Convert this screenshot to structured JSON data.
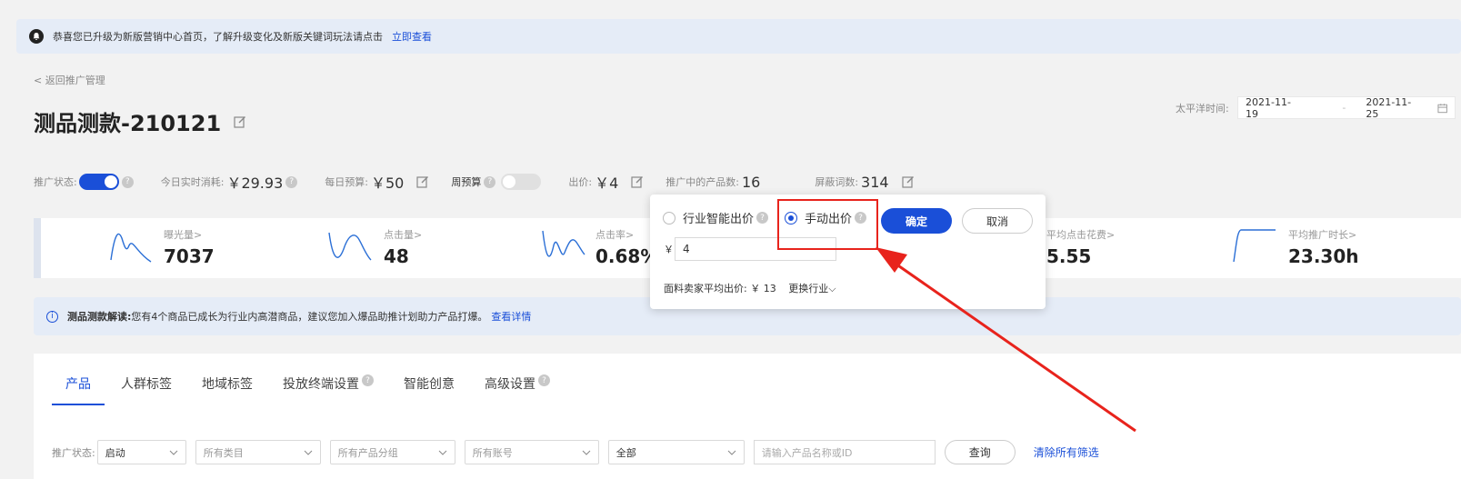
{
  "notice": {
    "text": "恭喜您已升级为新版营销中心首页，了解升级变化及新版关键词玩法请点击",
    "link": "立即查看"
  },
  "back_link": "< 返回推广管理",
  "title": "测品测款-210121",
  "date_range": {
    "label": "太平洋时间:",
    "start": "2021-11-19",
    "separator": "-",
    "end": "2021-11-25"
  },
  "status_bar": {
    "promo_status_label": "推广状态:",
    "promo_status_on": true,
    "today_spend_label": "今日实时消耗:",
    "today_spend_value": "￥29.93",
    "daily_budget_label": "每日预算:",
    "daily_budget_value": "￥50",
    "weekly_budget_label": "周预算",
    "weekly_budget_on": false,
    "bid_label": "出价:",
    "bid_value": "￥4",
    "products_label": "推广中的产品数:",
    "products_value": "16",
    "blocked_label": "屏蔽词数:",
    "blocked_value": "314"
  },
  "metrics": [
    {
      "label": "曝光量>",
      "value": "7037"
    },
    {
      "label": "点击量>",
      "value": "48"
    },
    {
      "label": "点击率>",
      "value": "0.68%"
    },
    {
      "label": "平均点击花费>",
      "value": "5.55"
    },
    {
      "label": "平均推广时长>",
      "value": "23.30h"
    }
  ],
  "tip": {
    "title": "测品测款解读:",
    "text": "您有4个商品已成长为行业内高潜商品，建议您加入爆品助推计划助力产品打爆。",
    "link": "查看详情"
  },
  "tabs": [
    {
      "label": "产品",
      "active": true
    },
    {
      "label": "人群标签",
      "active": false
    },
    {
      "label": "地域标签",
      "active": false
    },
    {
      "label": "投放终端设置",
      "active": false
    },
    {
      "label": "智能创意",
      "active": false
    },
    {
      "label": "高级设置",
      "active": false
    }
  ],
  "filters": {
    "status_label": "推广状态:",
    "status_value": "启动",
    "category_placeholder": "所有类目",
    "group_placeholder": "所有产品分组",
    "account_placeholder": "所有账号",
    "scope_value": "全部",
    "search_placeholder": "请输入产品名称或ID",
    "query_button": "查询",
    "clear_link": "清除所有筛选"
  },
  "bid_popup": {
    "option_smart": "行业智能出价",
    "option_manual": "手动出价",
    "selected": "manual",
    "confirm": "确定",
    "cancel": "取消",
    "currency": "￥",
    "bid_input": "4",
    "avg_label": "面料卖家平均出价:",
    "avg_value": "￥ 13",
    "change_industry": "更换行业"
  },
  "colors": {
    "accent": "#1a4fd8",
    "annotation_red": "#e8231c",
    "banner_bg": "#e5ecf7"
  }
}
